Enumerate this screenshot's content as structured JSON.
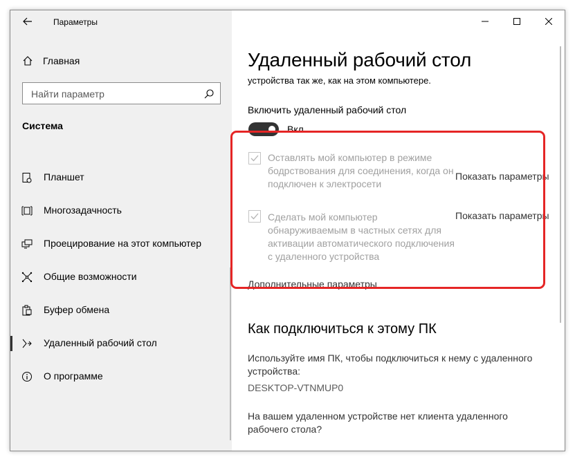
{
  "window": {
    "title": "Параметры"
  },
  "sidebar": {
    "home_label": "Главная",
    "search_placeholder": "Найти параметр",
    "section_title": "Система",
    "items": [
      {
        "label": "Планшет",
        "icon": "tablet-icon"
      },
      {
        "label": "Многозадачность",
        "icon": "multitasking-icon"
      },
      {
        "label": "Проецирование на этот компьютер",
        "icon": "projecting-icon"
      },
      {
        "label": "Общие возможности",
        "icon": "shared-experiences-icon"
      },
      {
        "label": "Буфер обмена",
        "icon": "clipboard-icon"
      },
      {
        "label": "Удаленный рабочий стол",
        "icon": "remote-desktop-icon",
        "selected": true
      },
      {
        "label": "О программе",
        "icon": "info-icon"
      }
    ]
  },
  "main": {
    "title": "Удаленный рабочий стол",
    "subtitle": "устройства так же, как на этом компьютере.",
    "toggle": {
      "label": "Включить удаленный рабочий стол",
      "state": "Вкл.",
      "on": true
    },
    "options": [
      {
        "text": "Оставлять мой компьютер в режиме бодрствования для соединения, когда он подключен к электросети",
        "checked": true,
        "disabled": true,
        "link": "Показать параметры"
      },
      {
        "text": "Сделать мой компьютер обнаруживаемым в частных сетях для активации автоматического подключения с удаленного устройства",
        "checked": true,
        "disabled": true,
        "link": "Показать параметры"
      }
    ],
    "advanced_link": "Дополнительные параметры",
    "connect_heading": "Как подключиться к этому ПК",
    "connect_text": "Используйте имя ПК, чтобы подключиться к нему с удаленного устройства:",
    "pc_name": "DESKTOP-VTNMUP0",
    "no_client_text": "На вашем удаленном устройстве нет клиента удаленного рабочего стола?"
  },
  "colors": {
    "highlight": "#e52525",
    "toggle_on": "#333333",
    "sidebar_bg": "#f0f0f0"
  }
}
